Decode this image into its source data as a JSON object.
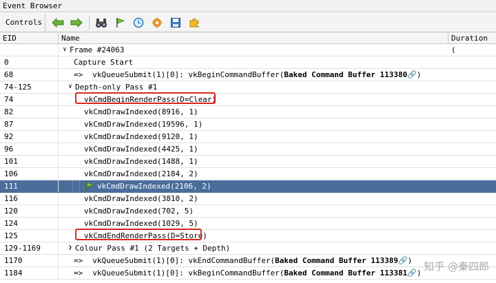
{
  "window": {
    "title": "Event Browser"
  },
  "toolbar": {
    "controls_label": "Controls",
    "buttons": [
      {
        "icon": "arrow-left-icon"
      },
      {
        "icon": "arrow-right-icon"
      },
      {
        "icon": "binoculars-icon"
      },
      {
        "icon": "flag-icon"
      },
      {
        "icon": "clock-icon"
      },
      {
        "icon": "gear-icon"
      },
      {
        "icon": "save-icon"
      },
      {
        "icon": "puzzle-icon"
      }
    ]
  },
  "columns": {
    "eid": "EID",
    "name": "Name",
    "duration": "Duration ("
  },
  "rows": [
    {
      "eid": "",
      "name": "Frame #24063"
    },
    {
      "eid": "0",
      "name": "Capture Start"
    },
    {
      "eid": "68",
      "name": "vkQueueSubmit(1)[0]:  vkBeginCommandBuffer(",
      "bold": "Baked Command Buffer 113380",
      "tail": ")"
    },
    {
      "eid": "74-125",
      "name": "Depth-only Pass #1"
    },
    {
      "eid": "74",
      "name": "vkCmdBeginRenderPass(D=Clear)"
    },
    {
      "eid": "82",
      "name": "vkCmdDrawIndexed(8916, 1)"
    },
    {
      "eid": "87",
      "name": "vkCmdDrawIndexed(19596, 1)"
    },
    {
      "eid": "92",
      "name": "vkCmdDrawIndexed(9120, 1)"
    },
    {
      "eid": "96",
      "name": "vkCmdDrawIndexed(4425, 1)"
    },
    {
      "eid": "101",
      "name": "vkCmdDrawIndexed(1488, 1)"
    },
    {
      "eid": "106",
      "name": "vkCmdDrawIndexed(2184, 2)"
    },
    {
      "eid": "111",
      "name": "vkCmdDrawIndexed(2106, 2)"
    },
    {
      "eid": "116",
      "name": "vkCmdDrawIndexed(3810, 2)"
    },
    {
      "eid": "120",
      "name": "vkCmdDrawIndexed(702, 5)"
    },
    {
      "eid": "124",
      "name": "vkCmdDrawIndexed(1029, 5)"
    },
    {
      "eid": "125",
      "name": "vkCmdEndRenderPass(D=Store)"
    },
    {
      "eid": "129-1169",
      "name": "Colour Pass #1 (2 Targets + Depth)"
    },
    {
      "eid": "1170",
      "name": "vkQueueSubmit(1)[0]:  vkEndCommandBuffer(",
      "bold": "Baked Command Buffer 113389",
      "tail": ")"
    },
    {
      "eid": "1184",
      "name": "vkQueueSubmit(1)[0]:  vkBeginCommandBuffer(",
      "bold": "Baked Command Buffer 113381",
      "tail": ")"
    }
  ],
  "watermark": "知乎 @秦四郎",
  "colors": {
    "selection": "#4a6d9c",
    "highlight_box": "#d9261c",
    "arrow_green": "#5aa02c"
  }
}
